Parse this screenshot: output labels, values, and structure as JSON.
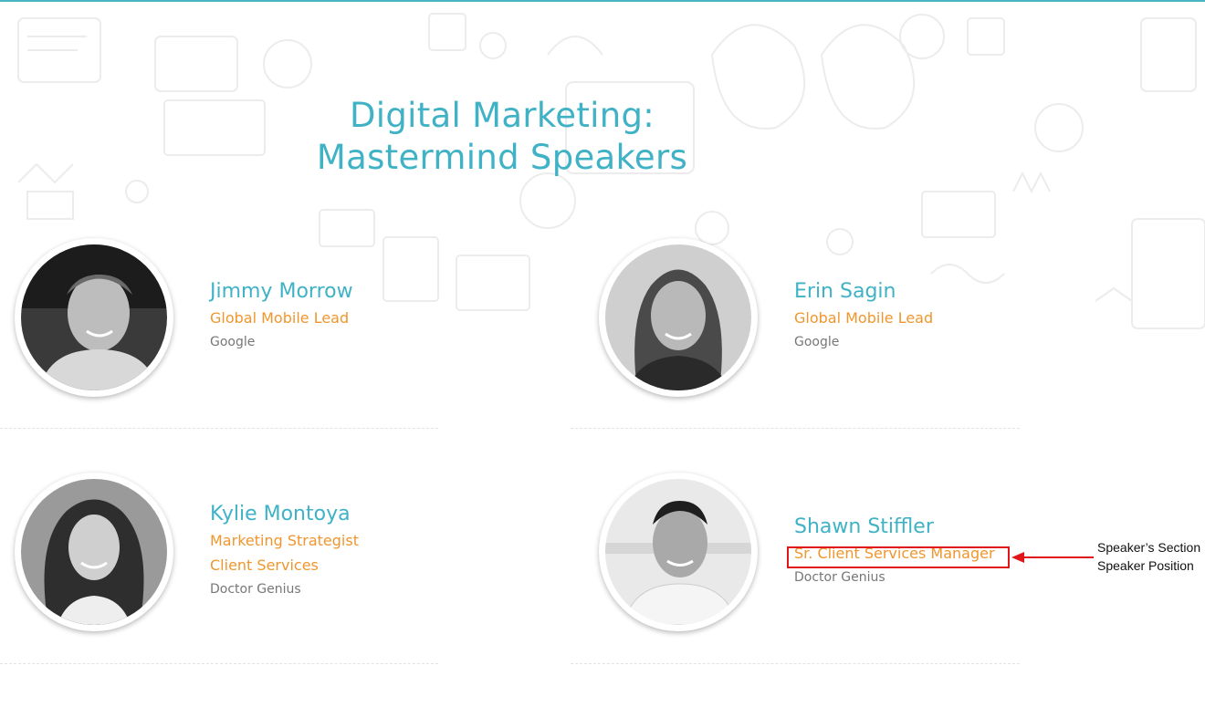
{
  "section": {
    "title_line1": "Digital Marketing:",
    "title_line2": "Mastermind Speakers"
  },
  "speakers": [
    {
      "name": "Jimmy Morrow",
      "position": "Global Mobile Lead",
      "company": "Google"
    },
    {
      "name": "Erin Sagin",
      "position": "Global Mobile Lead",
      "company": "Google"
    },
    {
      "name": "Kylie Montoya",
      "position": "Marketing Strategist",
      "position_line2": "Client Services",
      "company": "Doctor Genius"
    },
    {
      "name": "Shawn Stiffler",
      "position": "Sr. Client Services Manager",
      "company": "Doctor Genius"
    }
  ],
  "annotation": {
    "line1": "Speaker’s Section",
    "line2": "Speaker Position"
  },
  "colors": {
    "accent": "#3fb2c6",
    "position": "#f0962e",
    "company": "#777777",
    "annotation": "#e0161b"
  },
  "icons": {
    "background": "marketing-doodles",
    "pointer": "arrow-left-icon"
  }
}
